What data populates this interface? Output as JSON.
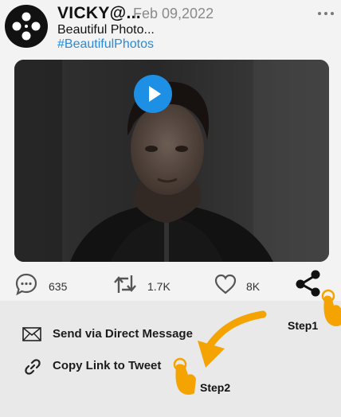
{
  "post": {
    "username": "VICKY@...",
    "date": "Feb 09,2022",
    "caption": "Beautiful Photo...",
    "hashtag": "#BeautifulPhotos",
    "accent_color": "#1d8fe4",
    "hashtag_color": "#2a8bd8"
  },
  "actions": {
    "comments": "635",
    "retweets": "1.7K",
    "likes": "8K"
  },
  "share_sheet": {
    "items": [
      {
        "label": "Send via Direct Message",
        "icon": "envelope-icon"
      },
      {
        "label": "Copy Link to Tweet",
        "icon": "link-icon"
      }
    ]
  },
  "annotations": {
    "step1": "Step1",
    "step2": "Step2",
    "arrow_color": "#f5a300"
  }
}
